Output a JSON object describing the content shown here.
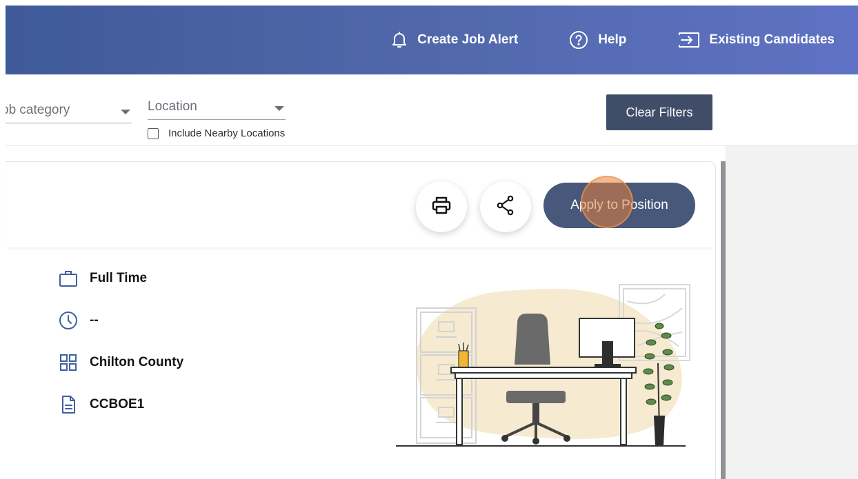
{
  "header": {
    "create_job_alert": "Create Job Alert",
    "help": "Help",
    "existing_candidates": "Existing Candidates"
  },
  "filters": {
    "job_category": "ob category",
    "location": "Location",
    "include_nearby": "Include Nearby Locations",
    "clear_filters": "Clear Filters"
  },
  "job": {
    "apply_label": "Apply to Position",
    "details": [
      {
        "icon": "briefcase-icon",
        "text": "Full Time"
      },
      {
        "icon": "clock-icon",
        "text": "--"
      },
      {
        "icon": "grid-icon",
        "text": "Chilton County"
      },
      {
        "icon": "document-icon",
        "text": "CCBOE1"
      }
    ]
  },
  "colors": {
    "header_gradient_start": "#3f5a98",
    "header_gradient_end": "#5f72c4",
    "button_dark": "#3f4d69",
    "apply_button": "#47587a",
    "icon_blue": "#3f5f9e"
  }
}
